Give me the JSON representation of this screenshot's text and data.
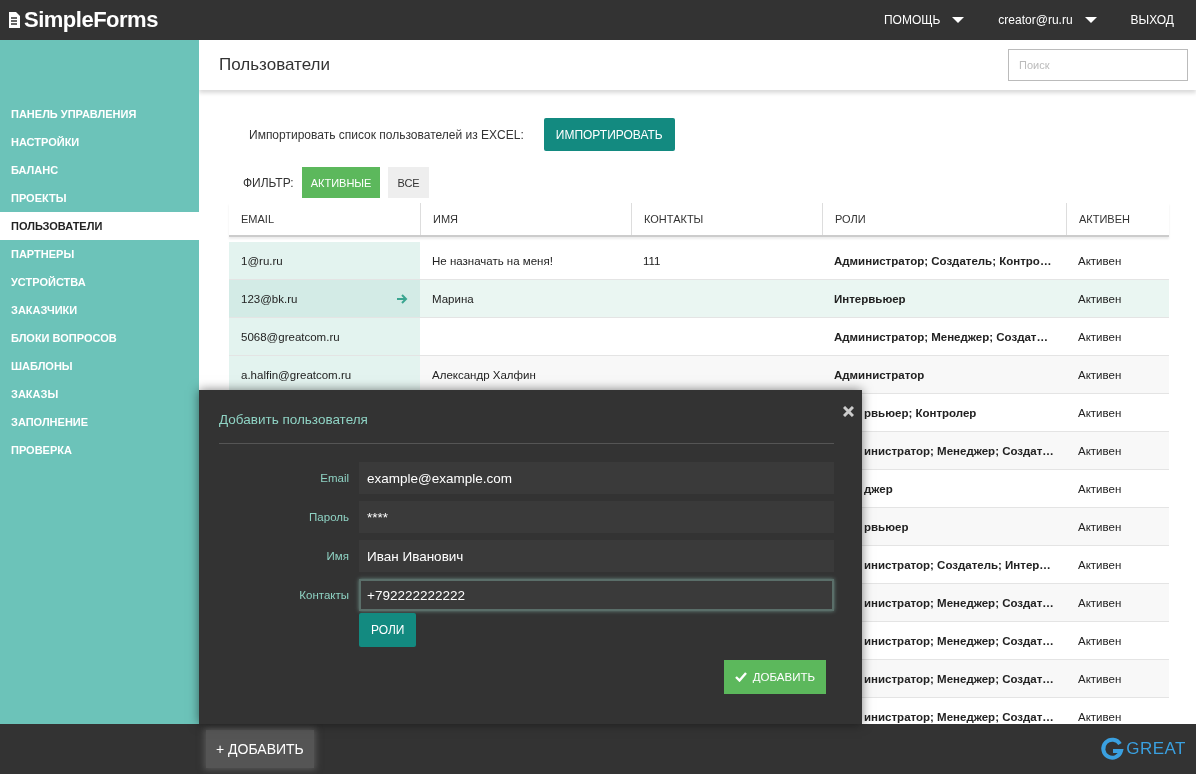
{
  "app": {
    "logo": "SimpleForms"
  },
  "top_nav": [
    {
      "label": "ПОМОЩЬ",
      "dropdown": true
    },
    {
      "label": "creator@ru.ru",
      "dropdown": true
    },
    {
      "label": "ВЫХОД",
      "dropdown": false
    }
  ],
  "sidebar": {
    "items": [
      {
        "label": "ПАНЕЛЬ УПРАВЛЕНИЯ",
        "selected": false
      },
      {
        "label": "НАСТРОЙКИ",
        "selected": false
      },
      {
        "label": "БАЛАНС",
        "selected": false
      },
      {
        "label": "ПРОЕКТЫ",
        "selected": false
      },
      {
        "label": "ПОЛЬЗОВАТЕЛИ",
        "selected": true
      },
      {
        "label": "ПАРТНЕРЫ",
        "selected": false
      },
      {
        "label": "УСТРОЙСТВА",
        "selected": false
      },
      {
        "label": "ЗАКАЗЧИКИ",
        "selected": false
      },
      {
        "label": "БЛОКИ ВОПРОСОВ",
        "selected": false
      },
      {
        "label": "ШАБЛОНЫ",
        "selected": false
      },
      {
        "label": "ЗАКАЗЫ",
        "selected": false
      },
      {
        "label": "ЗАПОЛНЕНИЕ",
        "selected": false
      },
      {
        "label": "ПРОВЕРКА",
        "selected": false
      }
    ]
  },
  "page": {
    "title": "Пользователи",
    "search": {
      "placeholder": "Поиск"
    }
  },
  "import": {
    "label": "Импортировать список пользователей из EXCEL:",
    "button": "ИМПОРТИРОВАТЬ"
  },
  "filter": {
    "label": "ФИЛЬТР:",
    "options": [
      {
        "label": "АКТИВНЫЕ",
        "selected": true
      },
      {
        "label": "ВСЕ",
        "selected": false
      }
    ]
  },
  "table": {
    "columns": [
      "EMAIL",
      "ИМЯ",
      "КОНТАКТЫ",
      "РОЛИ",
      "АКТИВЕН"
    ],
    "rows": [
      {
        "kind": "full",
        "selected": false,
        "email": "1@ru.ru",
        "name": "Не назначать на меня!",
        "contacts": "111",
        "roles": "Администратор; Создатель; Контро…",
        "status": "Активен"
      },
      {
        "kind": "full",
        "selected": true,
        "email": "123@bk.ru",
        "name": "Марина",
        "roles": "Интервьюер",
        "status": "Активен"
      },
      {
        "kind": "full",
        "selected": false,
        "email": "5068@greatcom.ru",
        "roles": "Администратор; Менеджер; Создат…",
        "status": "Активен"
      },
      {
        "kind": "full",
        "selected": false,
        "email": "a.halfin@greatcom.ru",
        "name": "Александр Халфин",
        "roles": "Администратор",
        "status": "Активен"
      },
      {
        "kind": "covered",
        "roles": "рвьюер; Контролер",
        "status": "Активен"
      },
      {
        "kind": "covered",
        "roles": "инистратор; Менеджер; Создат…",
        "status": "Активен"
      },
      {
        "kind": "covered",
        "roles": "джер",
        "status": "Активен"
      },
      {
        "kind": "covered",
        "roles": "рвьюер",
        "status": "Активен"
      },
      {
        "kind": "covered",
        "roles": "инистратор; Создатель; Интер…",
        "status": "Активен"
      },
      {
        "kind": "covered",
        "roles": "инистратор; Менеджер; Создат…",
        "status": "Активен"
      },
      {
        "kind": "covered",
        "roles": "инистратор; Менеджер; Создат…",
        "status": "Активен"
      },
      {
        "kind": "covered",
        "roles": "инистратор; Менеджер; Создат…",
        "status": "Активен"
      },
      {
        "kind": "covered",
        "roles": "инистратор; Менеджер; Создат…",
        "status": "Активен"
      }
    ]
  },
  "dialog": {
    "title": "Добавить пользователя",
    "fields": [
      {
        "label": "Email",
        "value": "example@example.com",
        "focused": false
      },
      {
        "label": "Пароль",
        "value": "****",
        "focused": false
      },
      {
        "label": "Имя",
        "value": "Иван Иванович",
        "focused": false
      },
      {
        "label": "Контакты",
        "value": "+792222222222",
        "focused": true
      }
    ],
    "roles_button": "РОЛИ",
    "submit_button": "ДОБАВИТЬ"
  },
  "bottom_bar": {
    "add_button": "+ ДОБАВИТЬ",
    "brand": "GREAT"
  }
}
